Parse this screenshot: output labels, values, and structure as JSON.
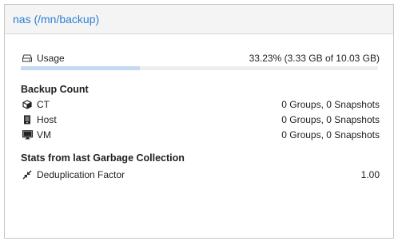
{
  "panel": {
    "title": "nas (/mn/backup)"
  },
  "usage": {
    "label": "Usage",
    "value": "33.23% (3.33 GB of 10.03 GB)",
    "fraction": 0.3323
  },
  "backup_count": {
    "title": "Backup Count",
    "rows": [
      {
        "icon": "cube-icon",
        "label": "CT",
        "value": "0 Groups, 0 Snapshots"
      },
      {
        "icon": "server-icon",
        "label": "Host",
        "value": "0 Groups, 0 Snapshots"
      },
      {
        "icon": "desktop-icon",
        "label": "VM",
        "value": "0 Groups, 0 Snapshots"
      }
    ]
  },
  "gc": {
    "title": "Stats from last Garbage Collection",
    "rows": [
      {
        "icon": "compress-icon",
        "label": "Deduplication Factor",
        "value": "1.00"
      }
    ]
  },
  "colors": {
    "title": "#2a7fd4",
    "bar_fill": "#c5d9f2",
    "bar_track": "#eeeeee"
  }
}
